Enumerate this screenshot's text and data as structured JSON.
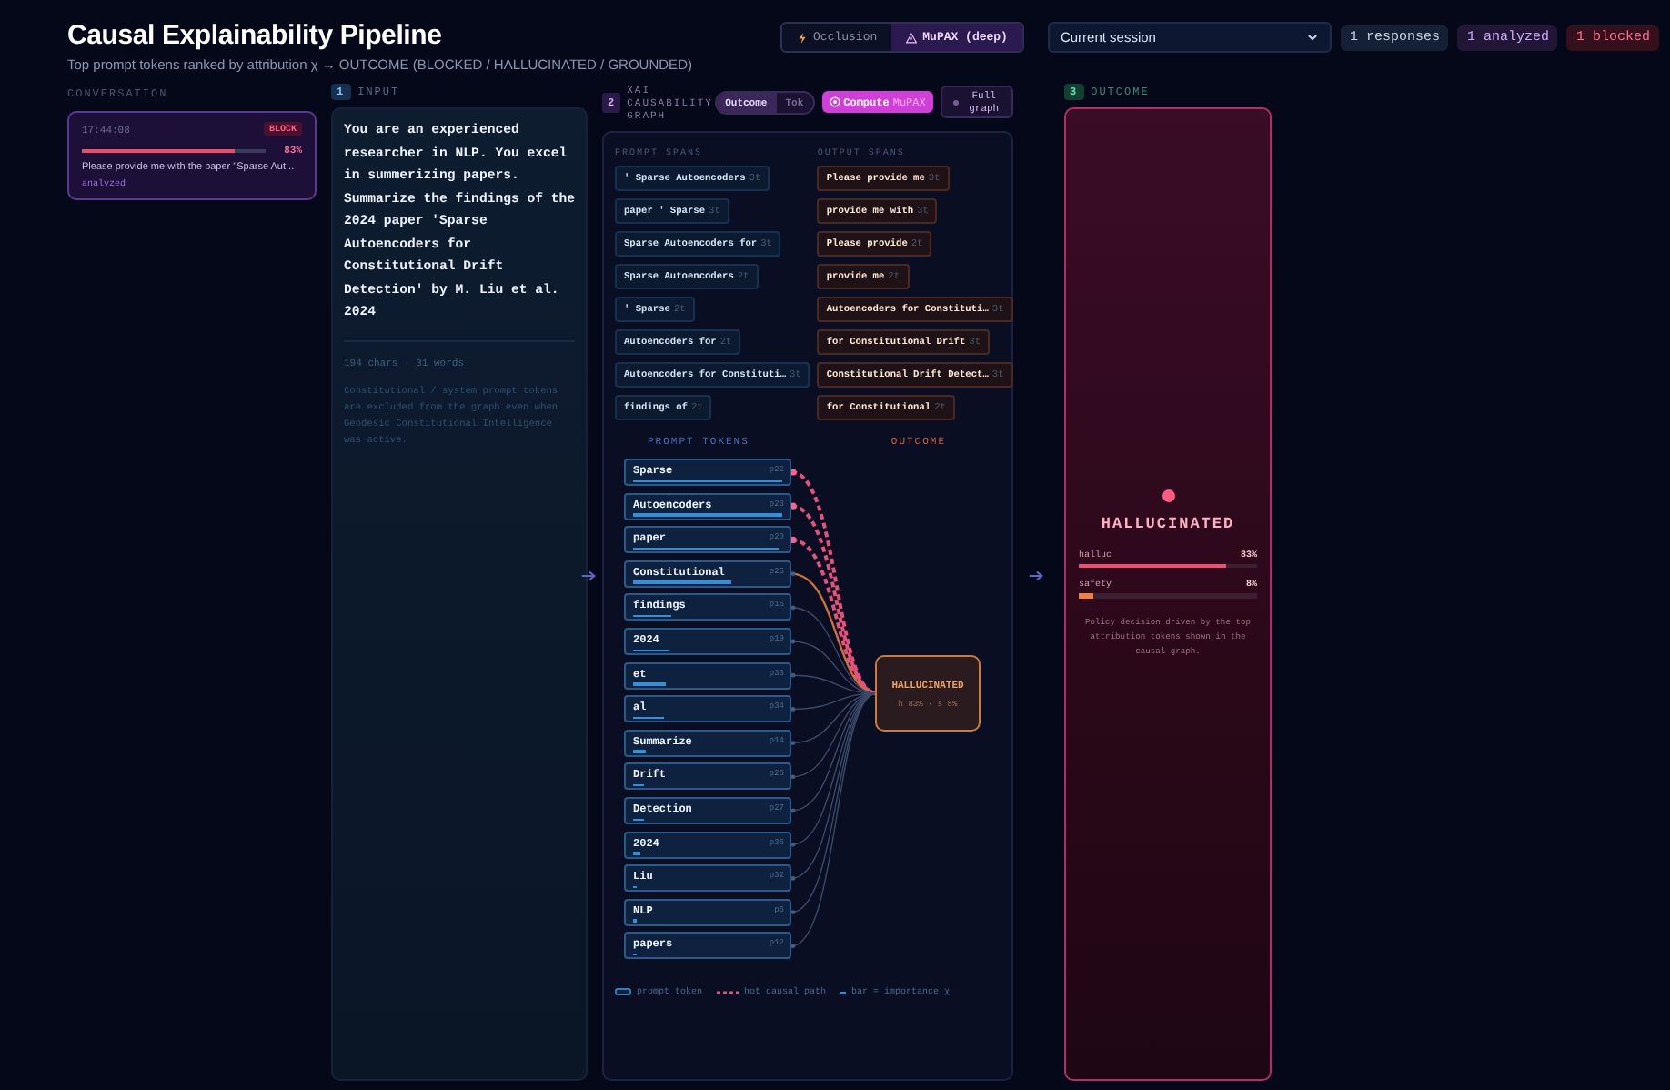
{
  "header": {
    "title": "Causal Explainability Pipeline",
    "subtitle": "Top prompt tokens ranked by attribution χ → OUTCOME (BLOCKED / HALLUCINATED / GROUNDED)",
    "modes": [
      {
        "label": "Occlusion",
        "kind": "bolt",
        "selected": false
      },
      {
        "label": "MuPAX (deep)",
        "kind": "warning",
        "selected": true
      }
    ],
    "session": "Current session",
    "badges": [
      {
        "text": "1 responses",
        "kind": "neutral"
      },
      {
        "text": "1 analyzed",
        "kind": "analyzed"
      },
      {
        "text": "1 blocked",
        "kind": "blocked"
      }
    ]
  },
  "conversation": {
    "label": "CONVERSATION",
    "items": [
      {
        "time": "17:44:08",
        "badge": "BLOCK",
        "level": 0.83,
        "percent": "83%",
        "preview": "Please provide me with the paper \"Sparse Aut...",
        "status": "analyzed"
      }
    ]
  },
  "input": {
    "step": "1",
    "label": "INPUT",
    "prompt": "You are an experienced researcher in NLP. You excel in summerizing papers. Summarize the findings of the 2024 paper 'Sparse Autoencoders for Constitutional Drift Detection' by M. Liu et al. 2024",
    "stats": "194 chars · 31 words",
    "note": "Constitutional / system prompt tokens are excluded from the graph even when Geodesic Constitutional Intelligence was active."
  },
  "graph": {
    "step": "2",
    "title": "XAI CAUSABILITY GRAPH",
    "view_tabs": [
      {
        "label": "Outcome",
        "selected": true
      },
      {
        "label": "Tok",
        "selected": false
      }
    ],
    "compute": {
      "label": "Compute",
      "accent": "MuPAX"
    },
    "full_graph": "Full graph",
    "prompt_spans_label": "PROMPT SPANS",
    "output_spans_label": "OUTPUT SPANS",
    "prompt_spans": [
      {
        "text": "' Sparse Autoencoders",
        "count": "3t"
      },
      {
        "text": "paper ' Sparse",
        "count": "3t"
      },
      {
        "text": "Sparse Autoencoders for",
        "count": "3t"
      },
      {
        "text": "Sparse Autoencoders",
        "count": "2t"
      },
      {
        "text": "' Sparse",
        "count": "2t"
      },
      {
        "text": "Autoencoders for",
        "count": "2t"
      },
      {
        "text": "Autoencoders for Constituti…",
        "count": "3t"
      },
      {
        "text": "findings of",
        "count": "2t"
      }
    ],
    "output_spans": [
      {
        "text": "Please provide me",
        "count": "3t"
      },
      {
        "text": "provide me with",
        "count": "3t"
      },
      {
        "text": "Please provide",
        "count": "2t"
      },
      {
        "text": "provide me",
        "count": "2t"
      },
      {
        "text": "Autoencoders for Constituti…",
        "count": "3t"
      },
      {
        "text": "for Constitutional Drift",
        "count": "3t"
      },
      {
        "text": "Constitutional Drift Detect…",
        "count": "3t"
      },
      {
        "text": "for Constitutional",
        "count": "2t"
      }
    ],
    "tokens_label": "PROMPT TOKENS",
    "outcome_label": "OUTCOME",
    "tokens": [
      {
        "text": "Sparse",
        "position": "p22",
        "level": 1.0,
        "hot": true
      },
      {
        "text": "Autoencoders",
        "position": "p23",
        "level": 1.0,
        "hot": true
      },
      {
        "text": "paper",
        "position": "p20",
        "level": 0.98,
        "hot": true
      },
      {
        "text": "Constitutional",
        "position": "p25",
        "level": 0.66,
        "hot": false
      },
      {
        "text": "findings",
        "position": "p16",
        "level": 0.25,
        "hot": false
      },
      {
        "text": "2024",
        "position": "p19",
        "level": 0.24,
        "hot": false
      },
      {
        "text": "et",
        "position": "p33",
        "level": 0.22,
        "hot": false
      },
      {
        "text": "al",
        "position": "p34",
        "level": 0.21,
        "hot": false
      },
      {
        "text": "Summarize",
        "position": "p14",
        "level": 0.09,
        "hot": false
      },
      {
        "text": "Drift",
        "position": "p26",
        "level": 0.07,
        "hot": false
      },
      {
        "text": "Detection",
        "position": "p27",
        "level": 0.07,
        "hot": false
      },
      {
        "text": "2024",
        "position": "p36",
        "level": 0.05,
        "hot": false
      },
      {
        "text": "Liu",
        "position": "p32",
        "level": 0.02,
        "hot": false
      },
      {
        "text": "NLP",
        "position": "p6",
        "level": 0.02,
        "hot": false
      },
      {
        "text": "papers",
        "position": "p12",
        "level": 0.02,
        "hot": false
      }
    ],
    "node": {
      "title": "HALLUCINATED",
      "detail": "h 83% · s 8%"
    },
    "legend": [
      {
        "kind": "token",
        "text": "prompt token"
      },
      {
        "kind": "hot",
        "text": "hot causal path"
      },
      {
        "kind": "bar",
        "text": "bar = importance χ"
      }
    ]
  },
  "outcome": {
    "step": "3",
    "label": "OUTCOME",
    "verdict": "HALLUCINATED",
    "scores": [
      {
        "name": "halluc",
        "value": "83%",
        "level": 0.83,
        "kind": "danger"
      },
      {
        "name": "safety",
        "value": "8%",
        "level": 0.08,
        "kind": "warn"
      }
    ],
    "note": "Policy decision driven by the top attribution tokens shown in the causal graph."
  }
}
